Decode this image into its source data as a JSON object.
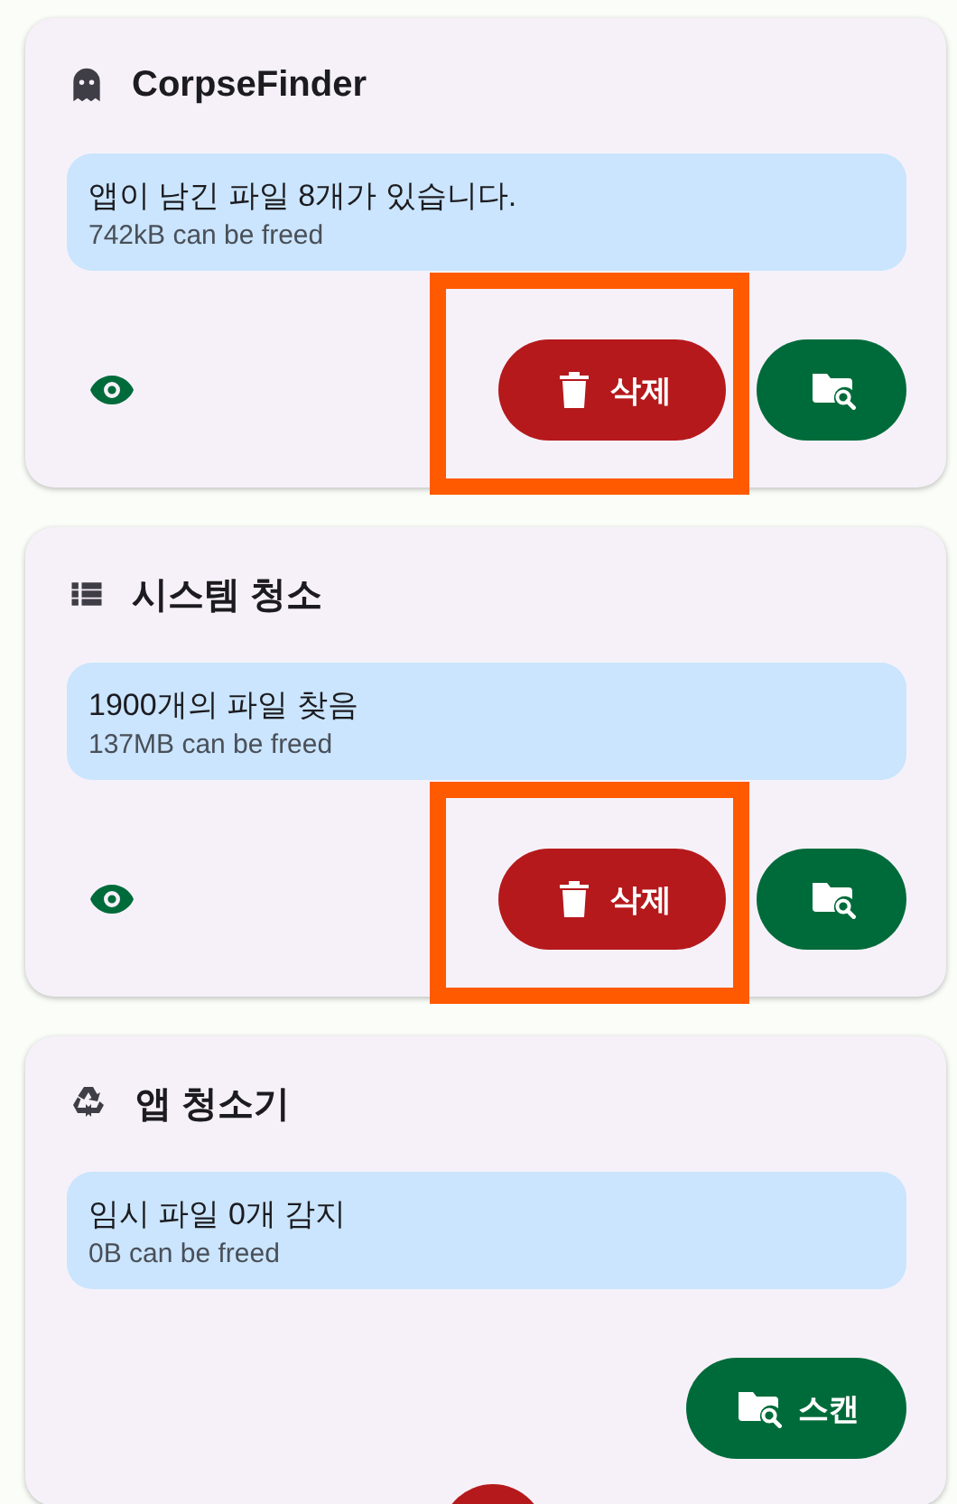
{
  "cards": [
    {
      "title": "CorpseFinder",
      "info": {
        "message": "앱이 남긴 파일 8개가 있습니다.",
        "freed": "742kB can be freed"
      },
      "actions": [
        {
          "kind": "preview"
        },
        {
          "kind": "delete",
          "label": "삭제",
          "highlighted": true
        },
        {
          "kind": "scan"
        }
      ]
    },
    {
      "title": "시스템 청소",
      "info": {
        "message": "1900개의 파일 찾음",
        "freed": "137MB can be freed"
      },
      "actions": [
        {
          "kind": "preview"
        },
        {
          "kind": "delete",
          "label": "삭제",
          "highlighted": true
        },
        {
          "kind": "scan"
        }
      ]
    },
    {
      "title": "앱 청소기",
      "info": {
        "message": "임시 파일 0개 감지",
        "freed": "0B can be freed"
      },
      "actions": [
        {
          "kind": "scan",
          "label": "스캔"
        }
      ]
    }
  ]
}
